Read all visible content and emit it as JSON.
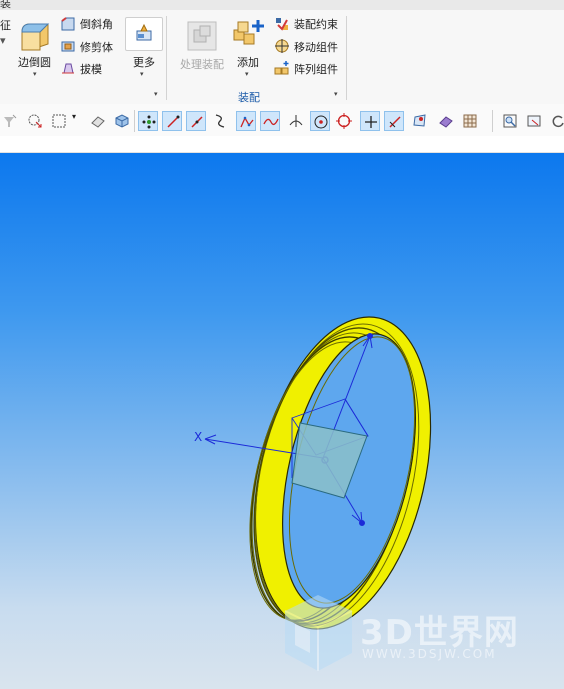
{
  "titlebar": {
    "fragment": "装"
  },
  "ribbon": {
    "feature_fragment": "征",
    "edge_blend": "边倒圆",
    "chamfer": "倒斜角",
    "trim_body": "修剪体",
    "draft": "拔模",
    "more": "更多",
    "process_assembly": "处理装配",
    "add": "添加",
    "assembly_constraint": "装配约束",
    "move_component": "移动组件",
    "pattern_component": "阵列组件",
    "assembly_group": "装配"
  },
  "toolbar": {
    "icons": [
      "filter-icon",
      "select-point-icon",
      "box-select-icon",
      "view-shaded-icon",
      "view-solid-icon",
      "snap-endpoint-icon",
      "snap-line-icon",
      "snap-curve-icon",
      "snap-spline-icon",
      "snap-polyline-icon",
      "snap-wave-icon",
      "snap-tangent-icon",
      "snap-center-icon",
      "snap-circle-icon",
      "snap-intersection-icon",
      "snap-on-line-icon",
      "snap-face-icon",
      "snap-mesh-icon",
      "snap-grid-icon",
      "zoom-fit-icon",
      "zoom-window-icon",
      "rotate-icon"
    ],
    "active": [
      "snap-endpoint-icon",
      "snap-line-icon",
      "snap-curve-icon",
      "snap-polyline-icon",
      "snap-wave-icon",
      "snap-center-icon",
      "snap-intersection-icon",
      "snap-on-line-icon"
    ]
  },
  "viewport": {
    "axis_label": "X",
    "watermark_title": "3D世界网",
    "watermark_url": "WWW.3DSJW.COM",
    "part_color": "#f0f000",
    "axis_color": "#1c2bd8"
  }
}
